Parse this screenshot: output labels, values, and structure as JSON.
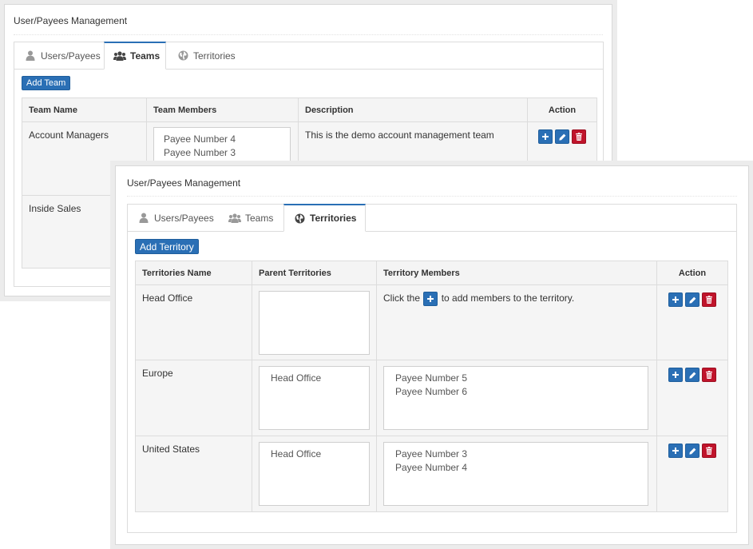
{
  "back_window": {
    "title": "User/Payees Management",
    "tabs": [
      {
        "label": "Users/Payees",
        "icon": "user-icon",
        "active": false
      },
      {
        "label": "Teams",
        "icon": "users-icon",
        "active": true
      },
      {
        "label": "Territories",
        "icon": "globe-icon",
        "active": false
      }
    ],
    "add_button": "Add Team",
    "columns": [
      "Team Name",
      "Team Members",
      "Description",
      "Action"
    ],
    "rows": [
      {
        "name": "Account Managers",
        "members": [
          "Payee Number 4",
          "Payee Number 3"
        ],
        "description": "This is the demo account management team"
      },
      {
        "name": "Inside Sales",
        "members": [],
        "description": ""
      }
    ]
  },
  "front_window": {
    "title": "User/Payees Management",
    "tabs": [
      {
        "label": "Users/Payees",
        "icon": "user-icon",
        "active": false
      },
      {
        "label": "Teams",
        "icon": "users-icon",
        "active": false
      },
      {
        "label": "Territories",
        "icon": "globe-icon",
        "active": true
      }
    ],
    "add_button": "Add Territory",
    "columns": [
      "Territories Name",
      "Parent Territories",
      "Territory Members",
      "Action"
    ],
    "hint_before": "Click the",
    "hint_after": "to add members to the territory.",
    "rows": [
      {
        "name": "Head Office",
        "parent": [],
        "members": []
      },
      {
        "name": "Europe",
        "parent": [
          "Head Office"
        ],
        "members": [
          "Payee Number 5",
          "Payee Number 6"
        ]
      },
      {
        "name": "United States",
        "parent": [
          "Head Office"
        ],
        "members": [
          "Payee Number 3",
          "Payee Number 4"
        ]
      }
    ]
  },
  "colors": {
    "primary": "#2a6fb5",
    "danger": "#c0142b",
    "header_bg": "#f4f4f4",
    "cell_bg": "#f5f5f5"
  }
}
